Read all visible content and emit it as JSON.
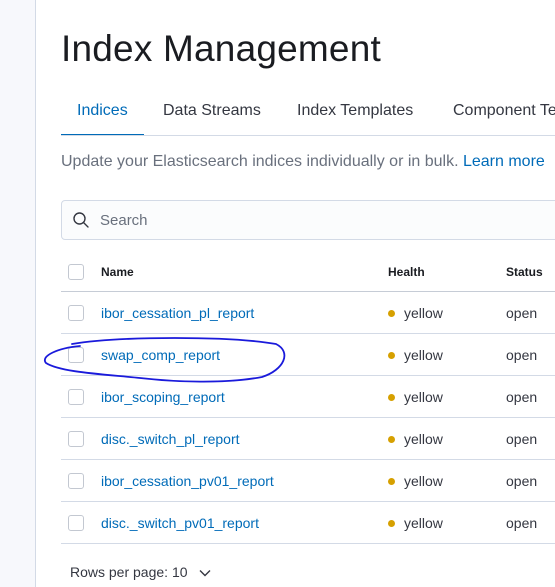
{
  "header": {
    "title": "Index Management"
  },
  "tabs": [
    {
      "label": "Indices",
      "active": true
    },
    {
      "label": "Data Streams",
      "active": false
    },
    {
      "label": "Index Templates",
      "active": false
    },
    {
      "label": "Component Templates",
      "active": false
    }
  ],
  "description": {
    "text": "Update your Elasticsearch indices individually or in bulk.",
    "link": "Learn more"
  },
  "search": {
    "placeholder": "Search",
    "value": ""
  },
  "table": {
    "columns": {
      "name": "Name",
      "health": "Health",
      "status": "Status"
    },
    "rows": [
      {
        "name": "ibor_cessation_pl_report",
        "health": "yellow",
        "status": "open"
      },
      {
        "name": "swap_comp_report",
        "health": "yellow",
        "status": "open"
      },
      {
        "name": "ibor_scoping_report",
        "health": "yellow",
        "status": "open"
      },
      {
        "name": "disc._switch_pl_report",
        "health": "yellow",
        "status": "open"
      },
      {
        "name": "ibor_cessation_pv01_report",
        "health": "yellow",
        "status": "open"
      },
      {
        "name": "disc._switch_pv01_report",
        "health": "yellow",
        "status": "open"
      }
    ]
  },
  "pagination": {
    "rows_per_page_label": "Rows per page: 10"
  },
  "colors": {
    "accent": "#006bb8",
    "health_yellow": "#d6a000",
    "annotation": "#1a1adb"
  },
  "icons": {
    "search": "search-icon",
    "chevron": "chevron-down-icon"
  }
}
